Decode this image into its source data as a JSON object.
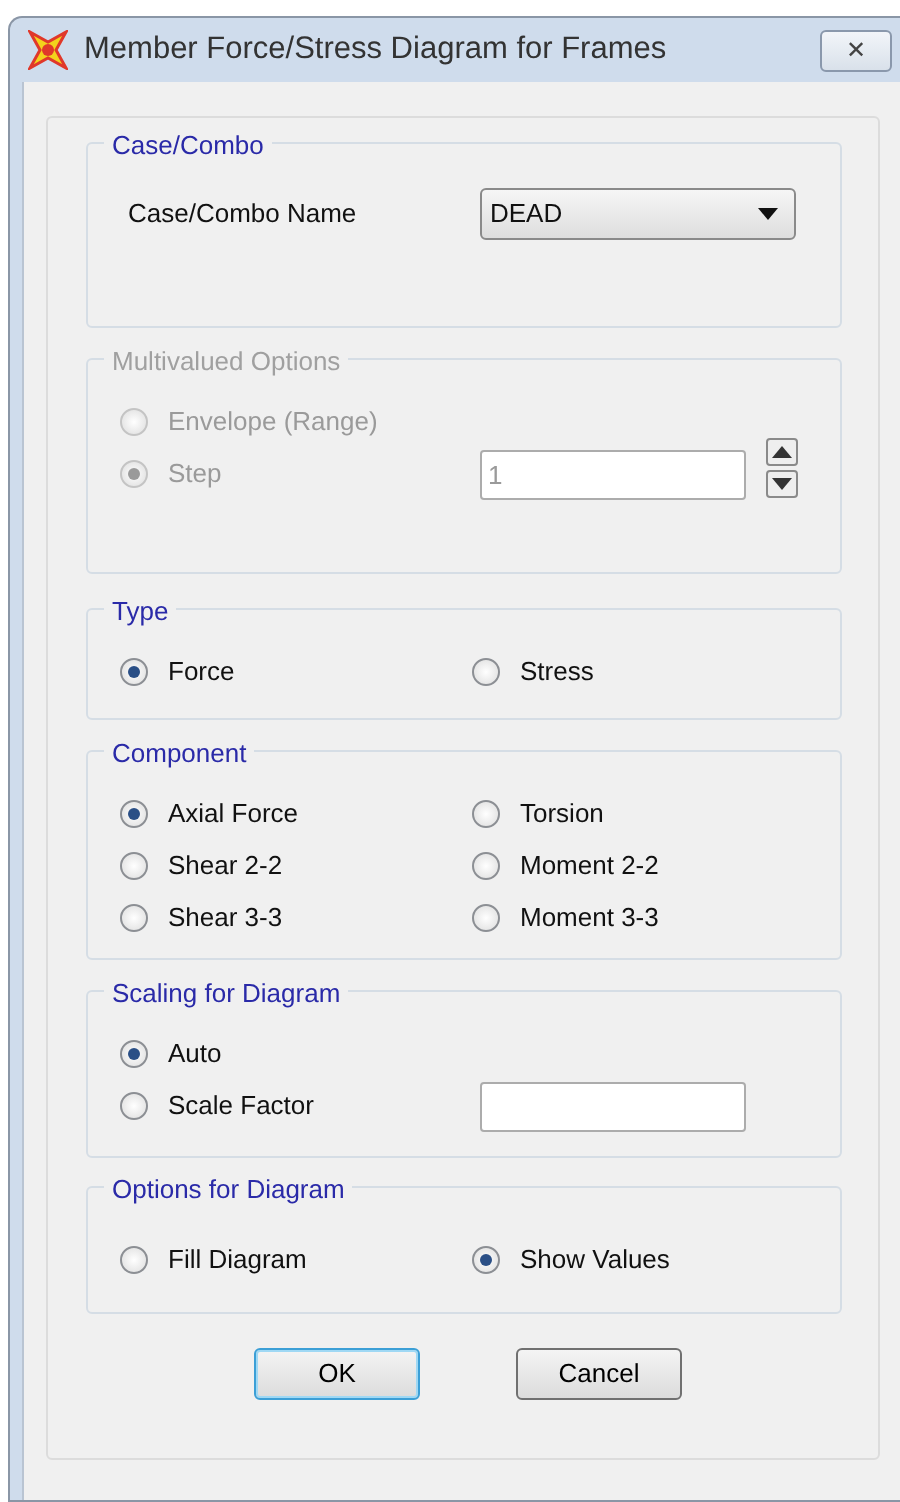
{
  "window": {
    "title": "Member Force/Stress Diagram for Frames",
    "close": "✕"
  },
  "groups": [
    {
      "legend": "Case/Combo",
      "disabled": false,
      "rows": [
        [
          {
            "kind": "label",
            "text": "Case/Combo Name"
          },
          {
            "kind": "dropdown",
            "value": "DEAD"
          }
        ]
      ]
    },
    {
      "legend": "Multivalued Options",
      "disabled": true,
      "rows": [
        [
          {
            "kind": "radio",
            "label": "Envelope (Range)",
            "selected": false
          }
        ],
        [
          {
            "kind": "radio",
            "label": "Step",
            "selected": true
          },
          {
            "kind": "field",
            "value": "1",
            "spinner": true
          }
        ]
      ]
    },
    {
      "legend": "Type",
      "disabled": false,
      "rows": [
        [
          {
            "kind": "radio",
            "label": "Force",
            "selected": true
          },
          {
            "kind": "radio",
            "label": "Stress",
            "selected": false
          }
        ]
      ]
    },
    {
      "legend": "Component",
      "disabled": false,
      "rows": [
        [
          {
            "kind": "radio",
            "label": "Axial Force",
            "selected": true
          },
          {
            "kind": "radio",
            "label": "Torsion",
            "selected": false
          }
        ],
        [
          {
            "kind": "radio",
            "label": "Shear 2-2",
            "selected": false
          },
          {
            "kind": "radio",
            "label": "Moment 2-2",
            "selected": false
          }
        ],
        [
          {
            "kind": "radio",
            "label": "Shear 3-3",
            "selected": false
          },
          {
            "kind": "radio",
            "label": "Moment 3-3",
            "selected": false
          }
        ]
      ]
    },
    {
      "legend": "Scaling for Diagram",
      "disabled": false,
      "rows": [
        [
          {
            "kind": "radio",
            "label": "Auto",
            "selected": true
          }
        ],
        [
          {
            "kind": "radio",
            "label": "Scale Factor",
            "selected": false
          },
          {
            "kind": "field"
          }
        ]
      ]
    },
    {
      "legend": "Options for Diagram",
      "disabled": false,
      "rows": [
        [
          {
            "kind": "radio",
            "label": "Fill Diagram",
            "selected": false
          },
          {
            "kind": "radio",
            "label": "Show Values",
            "selected": true
          }
        ]
      ]
    }
  ],
  "buttons": [
    {
      "label": "OK",
      "default": true
    },
    {
      "label": "Cancel",
      "default": false
    }
  ]
}
